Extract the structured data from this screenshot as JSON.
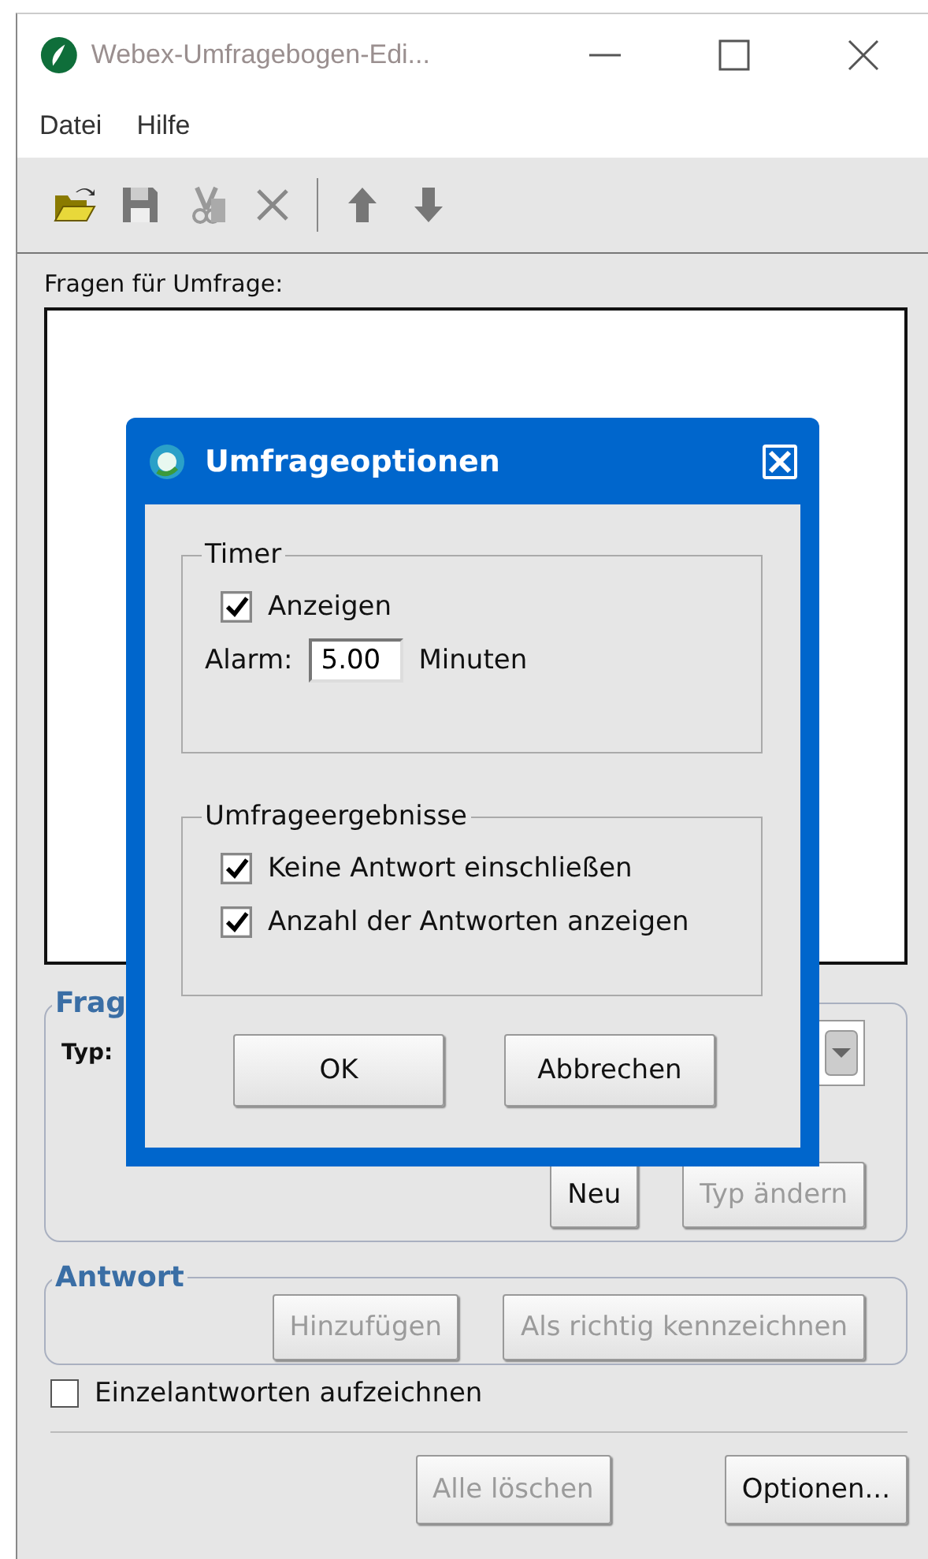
{
  "window": {
    "title": "Webex-Umfragebogen-Edi..."
  },
  "menu": [
    {
      "label": "Datei"
    },
    {
      "label": "Hilfe"
    }
  ],
  "questions": {
    "label": "Fragen für Umfrage:"
  },
  "question_group": {
    "legend": "Frag",
    "type_label": "Typ:",
    "buttons": [
      {
        "label": "Neu",
        "disabled": false
      },
      {
        "label": "Typ ändern",
        "disabled": true
      }
    ]
  },
  "answer_group": {
    "legend": "Antwort",
    "buttons": [
      {
        "label": "Hinzufügen",
        "disabled": true
      },
      {
        "label": "Als richtig kennzeichnen",
        "disabled": true
      }
    ]
  },
  "record_checkbox": {
    "label": "Einzelantworten aufzeichnen",
    "checked": false
  },
  "footer_buttons": [
    {
      "label": "Alle löschen",
      "disabled": true
    },
    {
      "label": "Optionen...",
      "disabled": false
    }
  ],
  "dialog": {
    "title": "Umfrageoptionen",
    "timer": {
      "legend": "Timer",
      "show": {
        "label": "Anzeigen",
        "checked": true
      },
      "alarm_label": "Alarm:",
      "alarm_value": "5.00",
      "unit": "Minuten"
    },
    "results": {
      "legend": "Umfrageergebnisse",
      "options": [
        {
          "label": "Keine Antwort einschließen",
          "checked": true
        },
        {
          "label": "Anzahl der Antworten anzeigen",
          "checked": true
        }
      ]
    },
    "buttons": [
      {
        "label": "OK"
      },
      {
        "label": "Abbrechen"
      }
    ]
  }
}
